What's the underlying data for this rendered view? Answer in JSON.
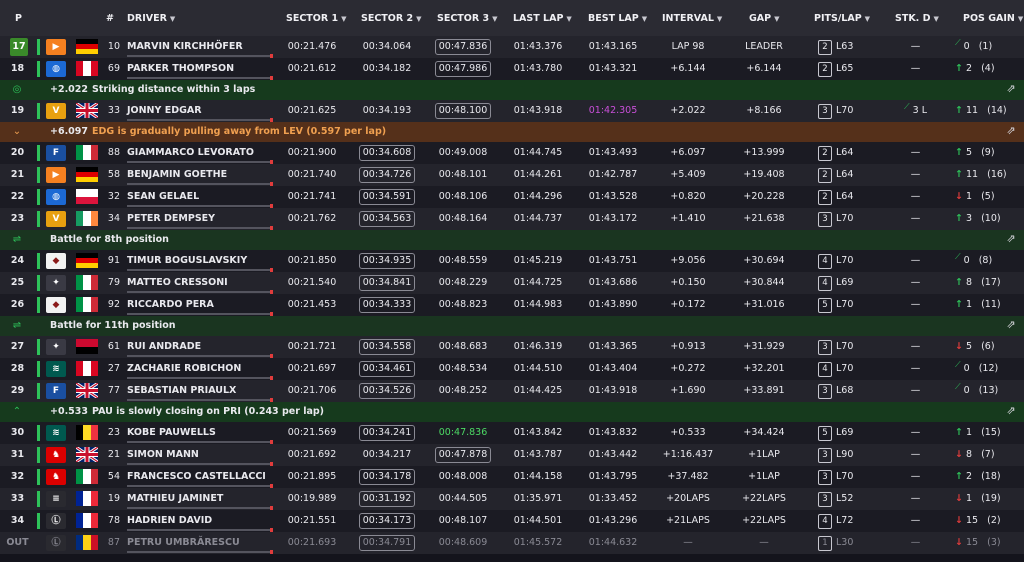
{
  "columns": {
    "p": "P",
    "num": "#",
    "driver": "DRIVER",
    "s1": "SECTOR 1",
    "s2": "SECTOR 2",
    "s3": "SECTOR 3",
    "last": "LAST LAP",
    "best": "BEST LAP",
    "interval": "INTERVAL",
    "gap": "GAP",
    "pits": "PITS/LAP",
    "stk": "STK. D",
    "posgain": "POS GAIN"
  },
  "colors": {
    "improved": "#2ec25a",
    "lost": "#e03c3c",
    "overall_best": "#c84fd8",
    "personal_best": "#4cd964"
  },
  "rows": [
    {
      "kind": "driver",
      "pos": "17",
      "team": "mclaren",
      "team_color": "#f58020",
      "team_glyph": "▶",
      "flag": [
        "#000000",
        "#dd0000",
        "#ffce00"
      ],
      "flag_dir": "h",
      "num": "10",
      "name": "MARVIN KIRCHHÖFER",
      "s1": "00:21.476",
      "s2": "00:34.064",
      "s3": "00:47.836",
      "s3_box": true,
      "last": "01:43.376",
      "best": "01:43.165",
      "interval": "LAP 98",
      "gap": "LEADER",
      "pits": "2",
      "lap": "L63",
      "stk": "—",
      "dir": "",
      "gain": "0",
      "gain_paren": "(1)"
    },
    {
      "kind": "driver",
      "pos": "18",
      "team": "bmw",
      "team_color": "#1c69d4",
      "team_glyph": "◍",
      "flag": [
        "#d80621",
        "#ffffff",
        "#d80621"
      ],
      "flag_dir": "v",
      "num": "69",
      "name": "PARKER THOMPSON",
      "s1": "00:21.612",
      "s2": "00:34.182",
      "s3": "00:47.986",
      "s3_box": true,
      "last": "01:43.780",
      "best": "01:43.321",
      "interval": "+6.144",
      "gap": "+6.144",
      "pits": "2",
      "lap": "L65",
      "stk": "—",
      "dir": "up",
      "gain": "2",
      "gain_paren": "(4)"
    },
    {
      "kind": "event",
      "style": "green",
      "icon": "◎",
      "delta": "+2.022",
      "msg": "Striking distance within 3 laps"
    },
    {
      "kind": "driver",
      "pos": "19",
      "team": "vantage",
      "team_color": "#e8a010",
      "team_glyph": "V",
      "flag": [
        "#012169",
        "#c8102e",
        "#ffffff"
      ],
      "flag_dir": "uk",
      "num": "33",
      "name": "JONNY EDGAR",
      "s1": "00:21.625",
      "s2": "00:34.193",
      "s3": "00:48.100",
      "s3_box": true,
      "last": "01:43.918",
      "best": "01:42.305",
      "best_purple": true,
      "interval": "+2.022",
      "gap": "+8.166",
      "pits": "3",
      "lap": "L70",
      "stk": "3 L",
      "dir": "up",
      "gain": "11",
      "gain_paren": "(14)"
    },
    {
      "kind": "event",
      "style": "orange",
      "icon": "⌄",
      "delta": "+6.097",
      "msg": "EDG is gradually pulling away from LEV (0.597 per lap)"
    },
    {
      "kind": "driver",
      "pos": "20",
      "team": "ford",
      "team_color": "#1a4fa0",
      "team_glyph": "F",
      "flag": [
        "#009246",
        "#ffffff",
        "#ce2b37"
      ],
      "flag_dir": "v",
      "num": "88",
      "name": "GIAMMARCO LEVORATO",
      "s1": "00:21.900",
      "s2": "00:34.608",
      "s2_box": true,
      "s3": "00:49.008",
      "last": "01:44.745",
      "best": "01:43.493",
      "interval": "+6.097",
      "gap": "+13.999",
      "pits": "2",
      "lap": "L64",
      "stk": "—",
      "dir": "up",
      "gain": "5",
      "gain_paren": "(9)"
    },
    {
      "kind": "driver",
      "pos": "21",
      "team": "mclaren",
      "team_color": "#f58020",
      "team_glyph": "▶",
      "flag": [
        "#000000",
        "#dd0000",
        "#ffce00"
      ],
      "flag_dir": "h",
      "num": "58",
      "name": "BENJAMIN GOETHE",
      "s1": "00:21.740",
      "s2": "00:34.726",
      "s2_box": true,
      "s3": "00:48.101",
      "last": "01:44.261",
      "best": "01:42.787",
      "interval": "+5.409",
      "gap": "+19.408",
      "pits": "2",
      "lap": "L64",
      "stk": "—",
      "dir": "up",
      "gain": "11",
      "gain_paren": "(16)"
    },
    {
      "kind": "driver",
      "pos": "22",
      "team": "bmw",
      "team_color": "#1c69d4",
      "team_glyph": "◍",
      "flag": [
        "#ffffff",
        "#dc143c"
      ],
      "flag_dir": "h",
      "num": "32",
      "name": "SEAN GELAEL",
      "s1": "00:21.741",
      "s2": "00:34.591",
      "s2_box": true,
      "s3": "00:48.106",
      "last": "01:44.296",
      "best": "01:43.528",
      "interval": "+0.820",
      "gap": "+20.228",
      "pits": "2",
      "lap": "L64",
      "stk": "—",
      "dir": "down",
      "gain": "1",
      "gain_paren": "(5)"
    },
    {
      "kind": "driver",
      "pos": "23",
      "team": "vantage",
      "team_color": "#e8a010",
      "team_glyph": "V",
      "flag": [
        "#169b62",
        "#ffffff",
        "#ff883e"
      ],
      "flag_dir": "v",
      "num": "34",
      "name": "PETER DEMPSEY",
      "s1": "00:21.762",
      "s2": "00:34.563",
      "s2_box": true,
      "s3": "00:48.164",
      "last": "01:44.737",
      "best": "01:43.172",
      "interval": "+1.410",
      "gap": "+21.638",
      "pits": "3",
      "lap": "L70",
      "stk": "—",
      "dir": "up",
      "gain": "3",
      "gain_paren": "(10)"
    },
    {
      "kind": "event",
      "style": "dgreen",
      "icon": "⇌",
      "delta": "",
      "msg": "Battle for 8th position"
    },
    {
      "kind": "driver",
      "pos": "24",
      "team": "porsche",
      "team_color": "#f2f2f2",
      "team_glyph": "◆",
      "flag": [
        "#000000",
        "#dd0000",
        "#ffce00"
      ],
      "flag_dir": "h",
      "num": "91",
      "name": "TIMUR BOGUSLAVSKIY",
      "s1": "00:21.850",
      "s2": "00:34.935",
      "s2_box": true,
      "s3": "00:48.559",
      "last": "01:45.219",
      "best": "01:43.751",
      "interval": "+9.056",
      "gap": "+30.694",
      "pits": "4",
      "lap": "L70",
      "stk": "—",
      "dir": "",
      "gain": "0",
      "gain_paren": "(8)"
    },
    {
      "kind": "driver",
      "pos": "25",
      "team": "mercedes",
      "team_color": "#3a3a44",
      "team_glyph": "✦",
      "flag": [
        "#009246",
        "#ffffff",
        "#ce2b37"
      ],
      "flag_dir": "v",
      "num": "79",
      "name": "MATTEO CRESSONI",
      "s1": "00:21.540",
      "s2": "00:34.841",
      "s2_box": true,
      "s3": "00:48.229",
      "last": "01:44.725",
      "best": "01:43.686",
      "interval": "+0.150",
      "gap": "+30.844",
      "pits": "4",
      "lap": "L69",
      "stk": "—",
      "dir": "up",
      "gain": "8",
      "gain_paren": "(17)"
    },
    {
      "kind": "driver",
      "pos": "26",
      "team": "porsche",
      "team_color": "#f2f2f2",
      "team_glyph": "◆",
      "flag": [
        "#009246",
        "#ffffff",
        "#ce2b37"
      ],
      "flag_dir": "v",
      "num": "92",
      "name": "RICCARDO PERA",
      "s1": "00:21.453",
      "s2": "00:34.333",
      "s2_box": true,
      "s3": "00:48.823",
      "last": "01:44.983",
      "best": "01:43.890",
      "interval": "+0.172",
      "gap": "+31.016",
      "pits": "5",
      "lap": "L70",
      "stk": "—",
      "dir": "up",
      "gain": "1",
      "gain_paren": "(11)"
    },
    {
      "kind": "event",
      "style": "dgreen",
      "icon": "⇌",
      "delta": "",
      "msg": "Battle for 11th position"
    },
    {
      "kind": "driver",
      "pos": "27",
      "team": "mercedes",
      "team_color": "#3a3a44",
      "team_glyph": "✦",
      "flag": [
        "#cc092f",
        "#000000"
      ],
      "flag_dir": "h",
      "num": "61",
      "name": "RUI ANDRADE",
      "s1": "00:21.721",
      "s2": "00:34.558",
      "s2_box": true,
      "s3": "00:48.683",
      "last": "01:46.319",
      "best": "01:43.365",
      "interval": "+0.913",
      "gap": "+31.929",
      "pits": "3",
      "lap": "L70",
      "stk": "—",
      "dir": "down",
      "gain": "5",
      "gain_paren": "(6)"
    },
    {
      "kind": "driver",
      "pos": "28",
      "team": "aston",
      "team_color": "#00594f",
      "team_glyph": "≋",
      "flag": [
        "#d80621",
        "#ffffff",
        "#d80621"
      ],
      "flag_dir": "v",
      "num": "27",
      "name": "ZACHARIE ROBICHON",
      "s1": "00:21.697",
      "s2": "00:34.461",
      "s2_box": true,
      "s3": "00:48.534",
      "last": "01:44.510",
      "best": "01:43.404",
      "interval": "+0.272",
      "gap": "+32.201",
      "pits": "4",
      "lap": "L70",
      "stk": "—",
      "dir": "",
      "gain": "0",
      "gain_paren": "(12)"
    },
    {
      "kind": "driver",
      "pos": "29",
      "team": "ford",
      "team_color": "#1a4fa0",
      "team_glyph": "F",
      "flag": [
        "#012169",
        "#c8102e",
        "#ffffff"
      ],
      "flag_dir": "uk",
      "num": "77",
      "name": "SEBASTIAN PRIAULX",
      "s1": "00:21.706",
      "s2": "00:34.526",
      "s2_box": true,
      "s3": "00:48.252",
      "last": "01:44.425",
      "best": "01:43.918",
      "interval": "+1.690",
      "gap": "+33.891",
      "pits": "3",
      "lap": "L68",
      "stk": "—",
      "dir": "",
      "gain": "0",
      "gain_paren": "(13)"
    },
    {
      "kind": "event",
      "style": "green",
      "icon": "⌃",
      "delta": "+0.533",
      "msg": "PAU is slowly closing on PRI (0.243 per lap)"
    },
    {
      "kind": "driver",
      "pos": "30",
      "team": "aston",
      "team_color": "#00594f",
      "team_glyph": "≋",
      "flag": [
        "#000000",
        "#fdda24",
        "#ef3340"
      ],
      "flag_dir": "v",
      "num": "23",
      "name": "KOBE PAUWELLS",
      "s1": "00:21.569",
      "s2": "00:34.241",
      "s2_box": true,
      "s3": "00:47.836",
      "s3_green": true,
      "last": "01:43.842",
      "best": "01:43.832",
      "interval": "+0.533",
      "gap": "+34.424",
      "pits": "5",
      "lap": "L69",
      "stk": "—",
      "dir": "up",
      "gain": "1",
      "gain_paren": "(15)"
    },
    {
      "kind": "driver",
      "pos": "31",
      "team": "ferrari",
      "team_color": "#dc0000",
      "team_glyph": "♞",
      "flag": [
        "#012169",
        "#c8102e",
        "#ffffff"
      ],
      "flag_dir": "uk",
      "num": "21",
      "name": "SIMON MANN",
      "s1": "00:21.692",
      "s2": "00:34.217",
      "s3": "00:47.878",
      "s3_box": true,
      "last": "01:43.787",
      "best": "01:43.442",
      "interval": "+1:16.437",
      "gap": "+1LAP",
      "pits": "3",
      "lap": "L90",
      "stk": "—",
      "dir": "down",
      "gain": "8",
      "gain_paren": "(7)"
    },
    {
      "kind": "driver",
      "pos": "32",
      "team": "ferrari",
      "team_color": "#dc0000",
      "team_glyph": "♞",
      "flag": [
        "#009246",
        "#ffffff",
        "#ce2b37"
      ],
      "flag_dir": "v",
      "num": "54",
      "name": "FRANCESCO CASTELLACCI",
      "s1": "00:21.895",
      "s2": "00:34.178",
      "s2_box": true,
      "s3": "00:48.008",
      "last": "01:44.158",
      "best": "01:43.795",
      "interval": "+37.482",
      "gap": "+1LAP",
      "pits": "3",
      "lap": "L70",
      "stk": "—",
      "dir": "up",
      "gain": "2",
      "gain_paren": "(18)"
    },
    {
      "kind": "driver",
      "pos": "33",
      "team": "genesis",
      "team_color": "#2a2a30",
      "team_glyph": "≡",
      "flag": [
        "#002395",
        "#ffffff",
        "#ed2939"
      ],
      "flag_dir": "v",
      "num": "19",
      "name": "MATHIEU JAMINET",
      "s1": "00:19.989",
      "s2": "00:31.192",
      "s2_box": true,
      "s3": "00:44.505",
      "last": "01:35.971",
      "best": "01:33.452",
      "interval": "+20LAPS",
      "gap": "+22LAPS",
      "pits": "3",
      "lap": "L52",
      "stk": "—",
      "dir": "down",
      "gain": "1",
      "gain_paren": "(19)"
    },
    {
      "kind": "driver",
      "pos": "34",
      "team": "lexus",
      "team_color": "#2a2a30",
      "team_glyph": "Ⓛ",
      "flag": [
        "#002395",
        "#ffffff",
        "#ed2939"
      ],
      "flag_dir": "v",
      "num": "78",
      "name": "HADRIEN DAVID",
      "s1": "00:21.551",
      "s2": "00:34.173",
      "s2_box": true,
      "s3": "00:48.107",
      "last": "01:44.501",
      "best": "01:43.296",
      "interval": "+21LAPS",
      "gap": "+22LAPS",
      "pits": "4",
      "lap": "L72",
      "stk": "—",
      "dir": "down",
      "gain": "15",
      "gain_paren": "(2)"
    },
    {
      "kind": "driver",
      "out": true,
      "pos": "OUT",
      "team": "lexus",
      "team_color": "#2a2a30",
      "team_glyph": "Ⓛ",
      "flag": [
        "#002b7f",
        "#fcd116",
        "#ce1126"
      ],
      "flag_dir": "v",
      "num": "87",
      "name": "PETRU UMBRĂRESCU",
      "s1": "00:21.693",
      "s2": "00:34.791",
      "s2_box": true,
      "s3": "00:48.609",
      "last": "01:45.572",
      "best": "01:44.632",
      "interval": "—",
      "gap": "—",
      "pits": "1",
      "lap": "L30",
      "stk": "—",
      "dir": "down",
      "gain": "15",
      "gain_paren": "(3)"
    }
  ]
}
